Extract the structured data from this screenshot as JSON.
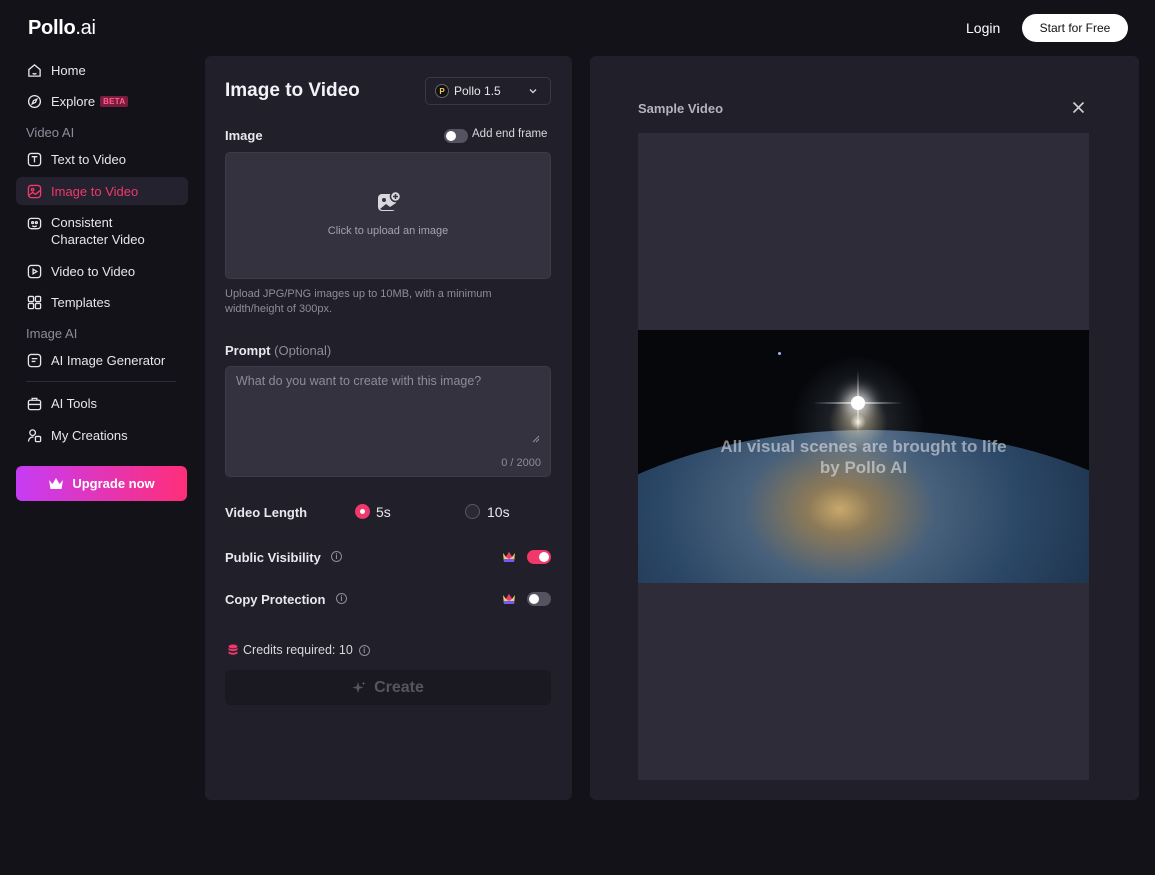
{
  "header": {
    "logo_main": "Pollo",
    "logo_suffix": ".ai",
    "login_label": "Login",
    "start_label": "Start for Free"
  },
  "sidebar": {
    "home": "Home",
    "explore": "Explore",
    "explore_badge": "BETA",
    "section_video": "Video AI",
    "text_to_video": "Text to Video",
    "image_to_video": "Image to Video",
    "consistent_line1": "Consistent",
    "consistent_line2": "Character Video",
    "video_to_video": "Video to Video",
    "templates": "Templates",
    "section_image": "Image AI",
    "ai_image_generator": "AI Image Generator",
    "ai_tools": "AI Tools",
    "my_creations": "My Creations",
    "upgrade": "Upgrade now"
  },
  "form": {
    "title": "Image to Video",
    "model": "Pollo 1.5",
    "image_label": "Image",
    "end_frame_label": "Add end frame",
    "upload_text": "Click to upload an image",
    "upload_hint": "Upload JPG/PNG images up to 10MB, with a minimum width/height of 300px.",
    "prompt_label": "Prompt",
    "prompt_optional": "(Optional)",
    "prompt_placeholder": "What do you want to create with this image?",
    "prompt_counter": "0 / 2000",
    "video_length_label": "Video Length",
    "length_5": "5s",
    "length_10": "10s",
    "public_visibility_label": "Public Visibility",
    "copy_protection_label": "Copy Protection",
    "credits_text": "Credits required: 10",
    "create_label": "Create"
  },
  "sample": {
    "title": "Sample Video",
    "caption_line1": "All visual scenes are brought to life",
    "caption_line2": "by Pollo AI"
  },
  "state": {
    "add_end_frame": false,
    "video_length": "5s",
    "public_visibility": true,
    "copy_protection": false
  },
  "colors": {
    "accent": "#f0386b",
    "background": "#131219",
    "panel": "#201f2a"
  }
}
